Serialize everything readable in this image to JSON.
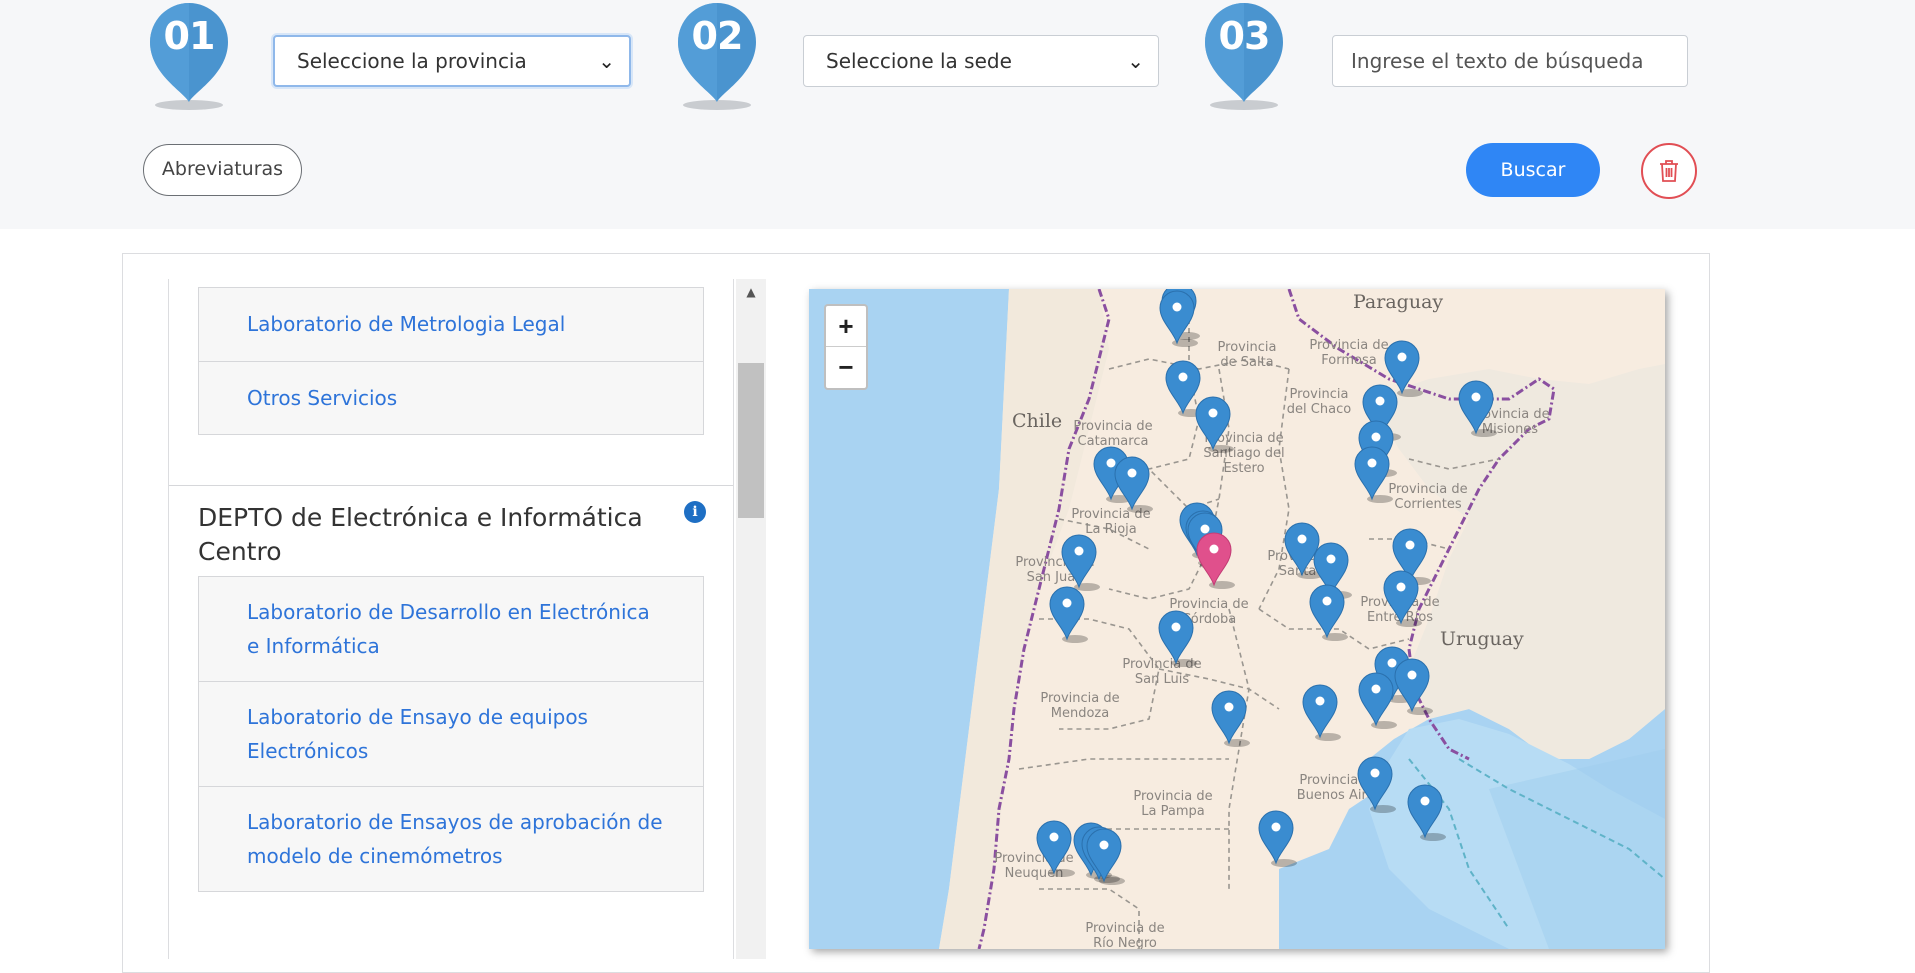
{
  "steps": [
    "01",
    "02",
    "03"
  ],
  "search": {
    "province_select": "Seleccione la provincia",
    "site_select": "Seleccione la sede",
    "text_placeholder": "Ingrese el texto de búsqueda",
    "abbreviations_label": "Abreviaturas",
    "search_label": "Buscar",
    "clear_icon": "trash-icon"
  },
  "colors": {
    "primary": "#2f86f5",
    "marker": "#3a8cd0",
    "marker_selected": "#e0508c",
    "danger": "#e14e54",
    "link": "#2e74d9"
  },
  "list": {
    "group1": [
      "Laboratorio de Metrologia Legal",
      "Otros Servicios"
    ],
    "dept_title": "DEPTO de Electrónica e Informática Centro",
    "group2": [
      "Laboratorio de Desarrollo en Electrónica e Informática",
      "Laboratorio de Ensayo de equipos Electrónicos",
      "Laboratorio de Ensayos de aprobación de modelo de cinemómetros"
    ]
  },
  "map": {
    "zoom_in": "+",
    "zoom_out": "−",
    "countries": [
      "Paraguay",
      "Chile",
      "Uruguay"
    ],
    "provinces": [
      "Provincia de Salta",
      "Provincia de Formosa",
      "Provincia del Chaco",
      "Provincia de Catamarca",
      "Provincia de Santiago del Estero",
      "Provincia de Misiones",
      "Provincia de Corrientes",
      "Provincia de La Rioja",
      "Provincia de San Juan",
      "Provincia de Córdoba",
      "Provincia de Santa Fe",
      "Provincia de Entre Ríos",
      "Provincia de San Luis",
      "Provincia de Mendoza",
      "Provincia de La Pampa",
      "Provincia de Buenos Aires",
      "Provincia de Neuquén",
      "Provincia de Río Negro"
    ]
  }
}
